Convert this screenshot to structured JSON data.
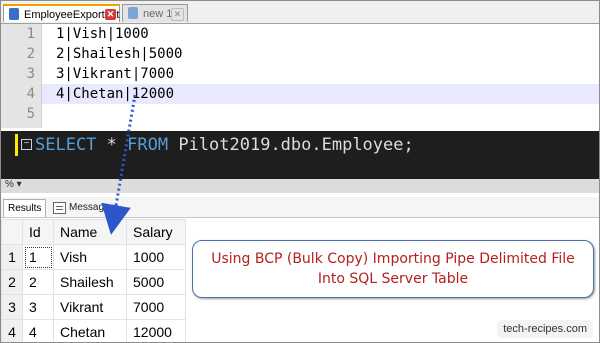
{
  "notepad": {
    "tabs": [
      {
        "label": "EmployeeExport.txt",
        "active": true
      },
      {
        "label": "new 1",
        "active": false
      }
    ],
    "lines": [
      {
        "num": "1",
        "text": "1|Vish|1000"
      },
      {
        "num": "2",
        "text": "2|Shailesh|5000"
      },
      {
        "num": "3",
        "text": "3|Vikrant|7000"
      },
      {
        "num": "4",
        "text": "4|Chetan|12000"
      },
      {
        "num": "5",
        "text": ""
      }
    ]
  },
  "query": {
    "kw_select": "SELECT",
    "star": " * ",
    "kw_from": "FROM",
    "target": " Pilot2019.dbo.Employee;",
    "zoom": "% ▾"
  },
  "results": {
    "tabs": {
      "results": "Results",
      "messages": "Messages"
    },
    "columns": [
      "Id",
      "Name",
      "Salary"
    ],
    "rows": [
      {
        "rownum": "1",
        "id": "1",
        "name": "Vish",
        "salary": "1000"
      },
      {
        "rownum": "2",
        "id": "2",
        "name": "Shailesh",
        "salary": "5000"
      },
      {
        "rownum": "3",
        "id": "3",
        "name": "Vikrant",
        "salary": "7000"
      },
      {
        "rownum": "4",
        "id": "4",
        "name": "Chetan",
        "salary": "12000"
      }
    ]
  },
  "note": {
    "line1": "Using BCP (Bulk Copy) Importing Pipe Delimited File",
    "line2": "Into SQL Server Table"
  },
  "credit": "tech-recipes.com",
  "colors": {
    "accent_tab": "#f2a200",
    "keyword": "#569cd6",
    "note_text": "#b42020",
    "arrow": "#2d56c9"
  }
}
